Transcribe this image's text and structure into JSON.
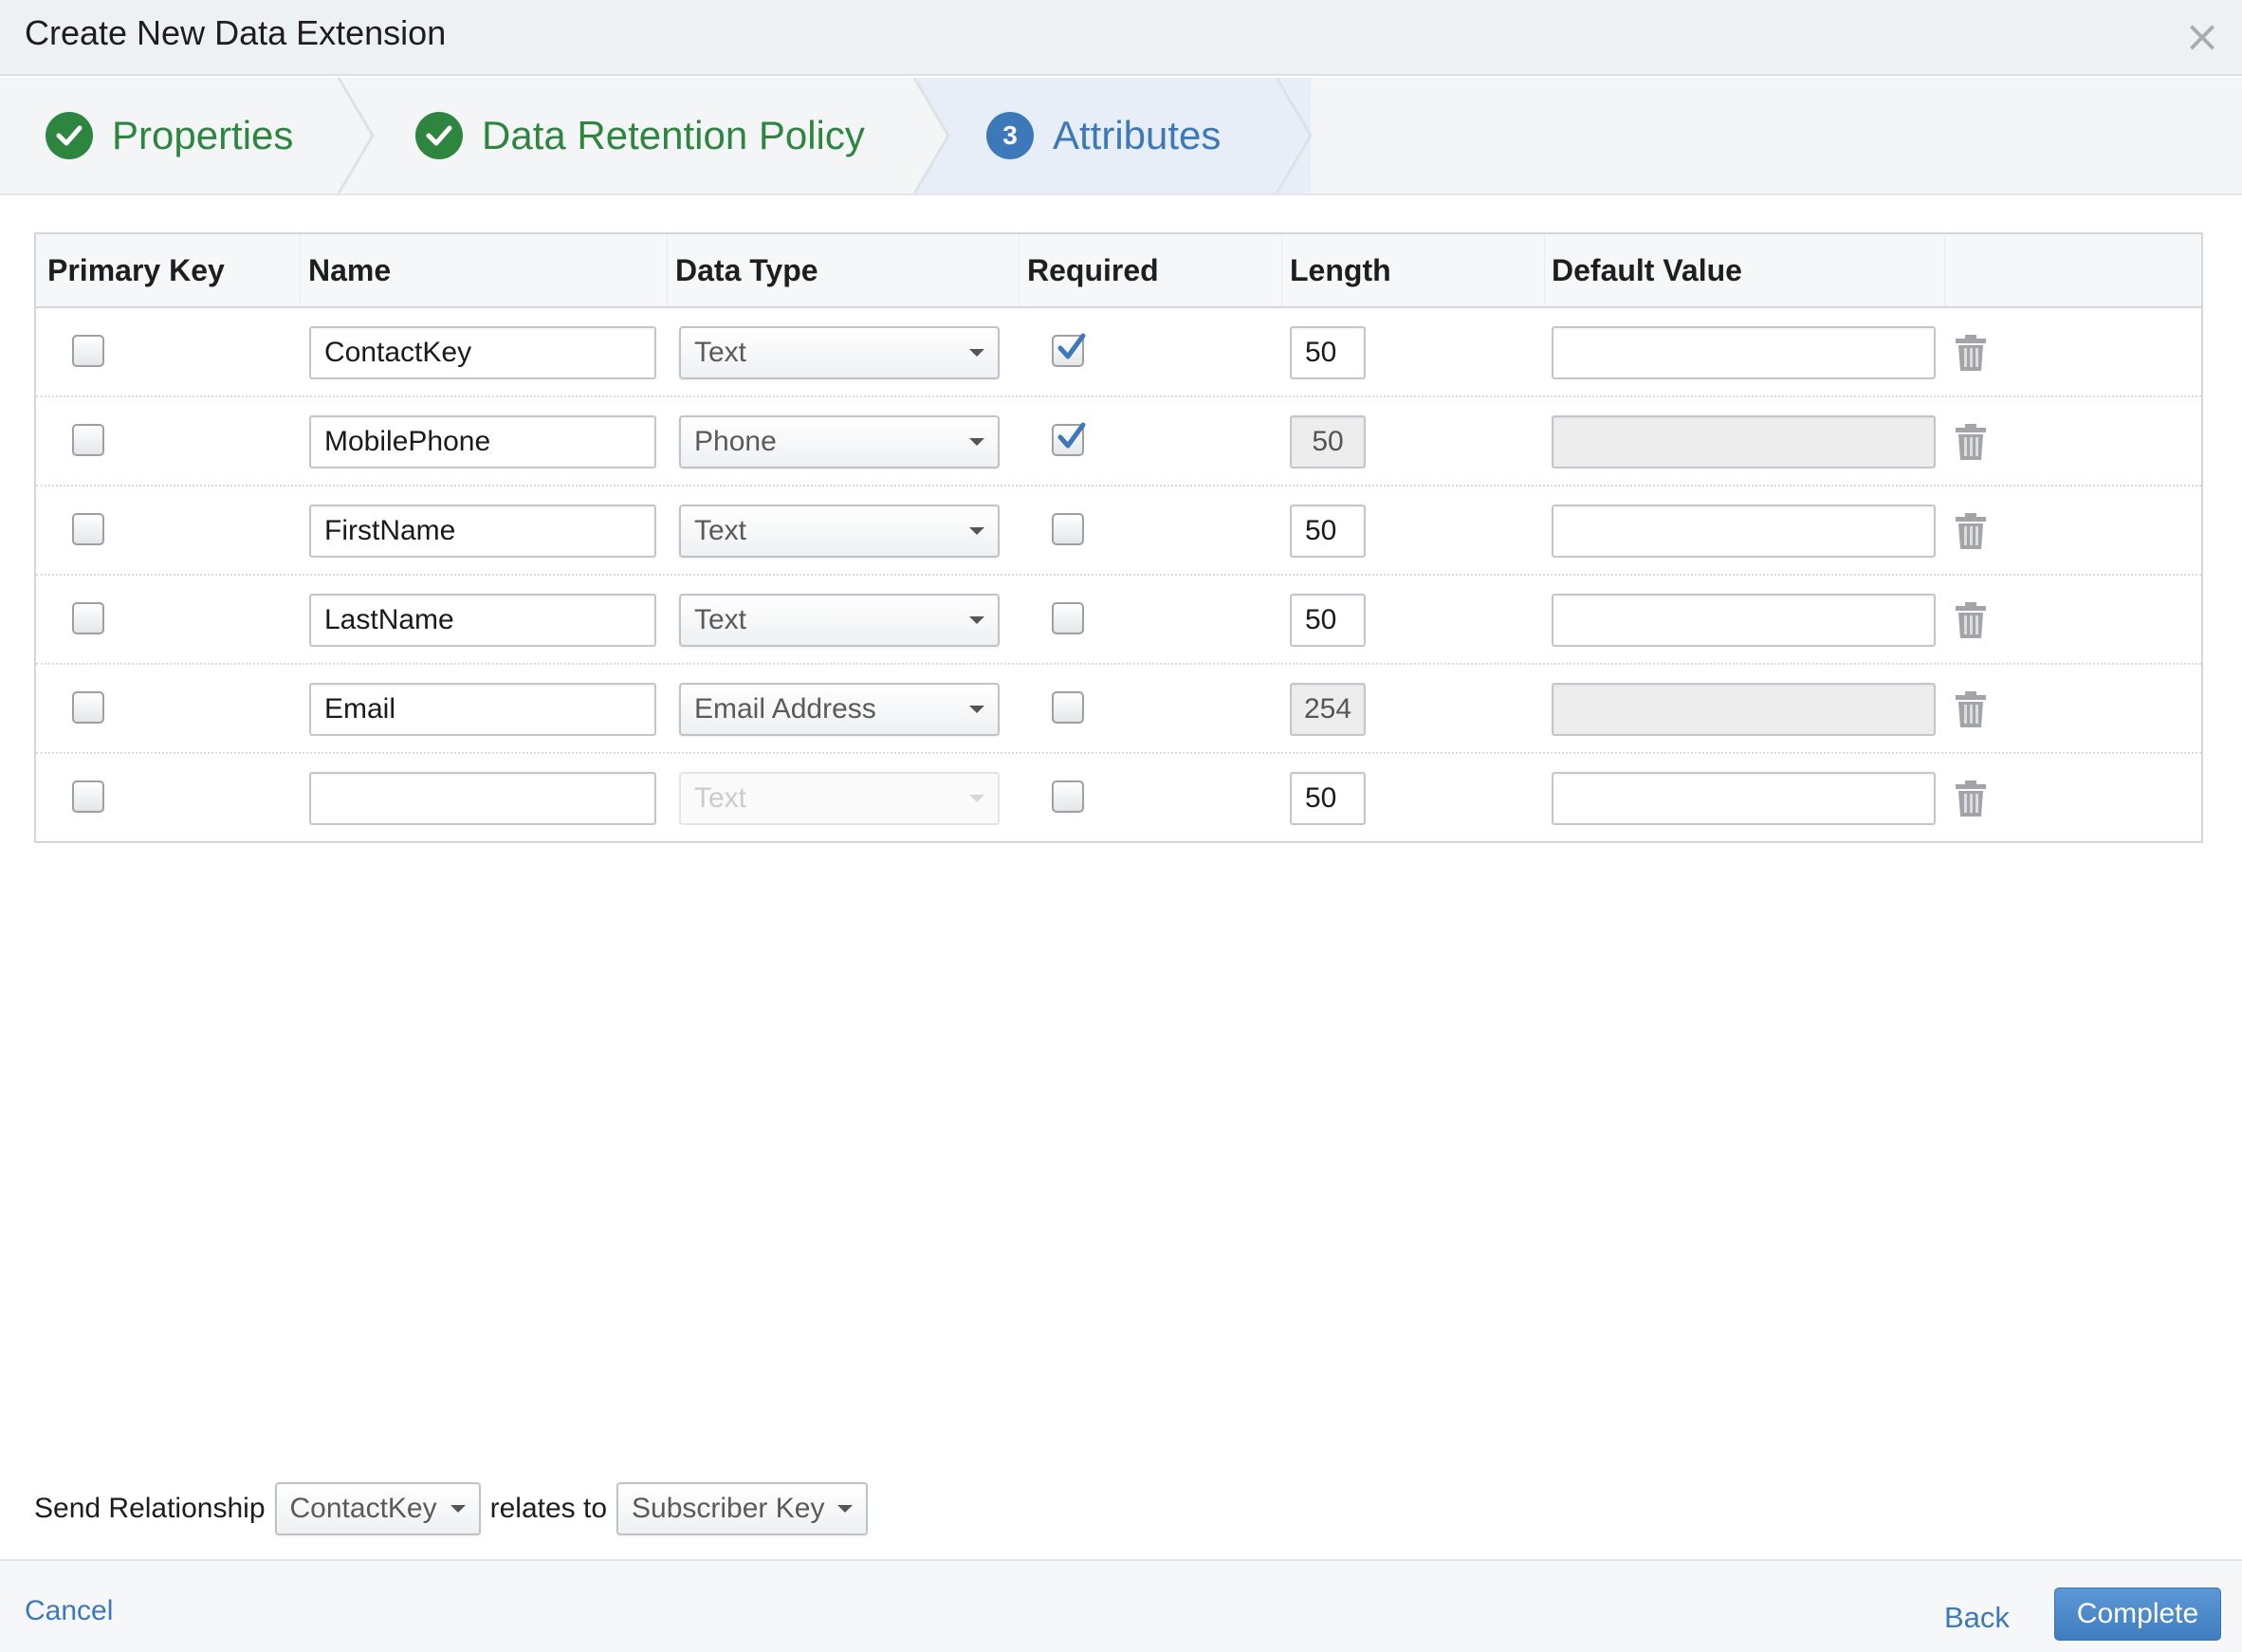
{
  "dialog": {
    "title": "Create New Data Extension",
    "close_symbol": "×"
  },
  "steps": [
    {
      "label": "Properties",
      "state": "done"
    },
    {
      "label": "Data Retention Policy",
      "state": "done"
    },
    {
      "label": "Attributes",
      "state": "active",
      "number": "3"
    }
  ],
  "table": {
    "headers": [
      "Primary Key",
      "Name",
      "Data Type",
      "Required",
      "Length",
      "Default Value"
    ],
    "rows": [
      {
        "primary_key": false,
        "name": "ContactKey",
        "data_type": "Text",
        "required": true,
        "length": "50",
        "default_value": "",
        "length_disabled": false,
        "default_disabled": false,
        "type_disabled": false
      },
      {
        "primary_key": false,
        "name": "MobilePhone",
        "data_type": "Phone",
        "required": true,
        "length": "50",
        "default_value": "",
        "length_disabled": true,
        "default_disabled": true,
        "type_disabled": false
      },
      {
        "primary_key": false,
        "name": "FirstName",
        "data_type": "Text",
        "required": false,
        "length": "50",
        "default_value": "",
        "length_disabled": false,
        "default_disabled": false,
        "type_disabled": false
      },
      {
        "primary_key": false,
        "name": "LastName",
        "data_type": "Text",
        "required": false,
        "length": "50",
        "default_value": "",
        "length_disabled": false,
        "default_disabled": false,
        "type_disabled": false
      },
      {
        "primary_key": false,
        "name": "Email",
        "data_type": "Email Address",
        "required": false,
        "length": "254",
        "default_value": "",
        "length_disabled": true,
        "default_disabled": true,
        "type_disabled": false
      },
      {
        "primary_key": false,
        "name": "",
        "data_type": "Text",
        "required": false,
        "length": "50",
        "default_value": "",
        "length_disabled": false,
        "default_disabled": false,
        "type_disabled": true
      }
    ]
  },
  "send_relationship": {
    "label": "Send Relationship",
    "field": "ContactKey",
    "relates_to_label": "relates to",
    "target": "Subscriber Key"
  },
  "footer": {
    "cancel": "Cancel",
    "back": "Back",
    "complete": "Complete"
  },
  "colors": {
    "done_green": "#2e8540",
    "active_blue": "#3d79b8",
    "check_blue": "#3d79b8"
  }
}
